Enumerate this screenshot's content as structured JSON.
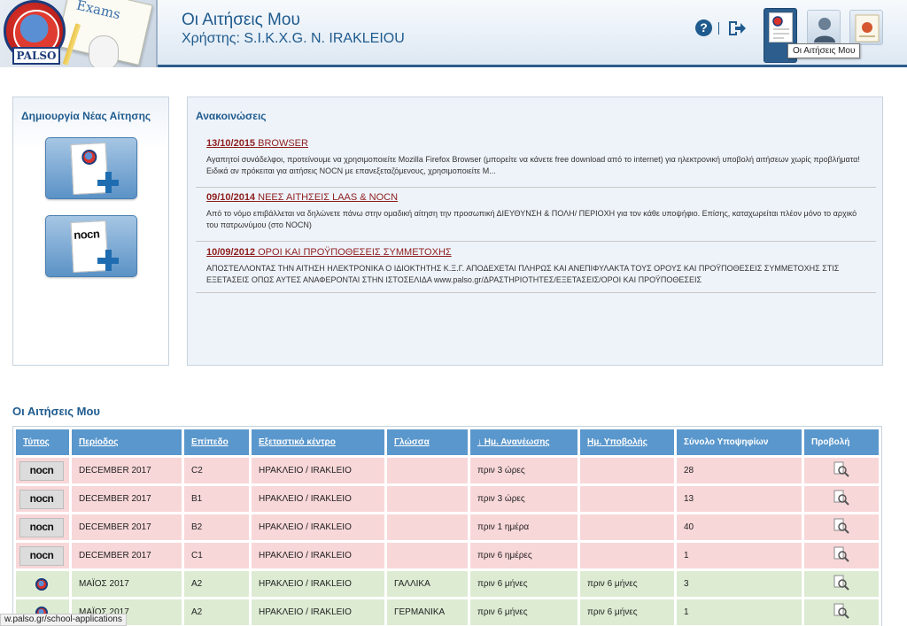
{
  "header": {
    "logo_text": "PALSO",
    "logo_tag": "Exams",
    "title": "Οι Αιτήσεις Μου",
    "user_label": "Χρήστης:",
    "user_name": "S.I.K.X.G. N. IRAKLEIOU",
    "help_symbol": "?",
    "tooltip": "Οι Αιτήσεις Μου"
  },
  "create_panel": {
    "title": "Δημιουργία Νέας Αίτησης",
    "buttons": [
      {
        "kind": "palso",
        "icon": "palso-application-add-icon"
      },
      {
        "kind": "nocn",
        "label": "nocn",
        "icon": "nocn-application-add-icon"
      }
    ]
  },
  "news": {
    "title": "Ανακοινώσεις",
    "items": [
      {
        "date": "13/10/2015",
        "headline": "BROWSER",
        "body": "Αγαπητοί συνάδελφοι, προτείνουμε να χρησιμοποιείτε Mozilla Firefox Browser (μπορείτε να κάνετε free download από το internet) για ηλεκτρονική υποβολή αιτήσεων χωρίς προβλήματα! Ειδικά αν πρόκειται για αιτήσεις NOCN με επανεξεταζόμενους, χρησιμοποιείτε M..."
      },
      {
        "date": "09/10/2014",
        "headline": "ΝΕΕΣ ΑΙΤΗΣΕΙΣ LAAS & NOCN",
        "body": "Από το νόμο επιβάλλεται να δηλώνετε πάνω στην ομαδική αίτηση την προσωπική ΔΙΕΥΘΥΝΣΗ & ΠΟΛΗ/ ΠΕΡΙΟΧΗ για τον κάθε υποψήφιο. Επίσης, καταχωρείται πλέον μόνο το αρχικό του πατρωνύμου (στο NOCN)"
      },
      {
        "date": "10/09/2012",
        "headline": "ΟΡΟΙ ΚΑΙ ΠΡΟΫΠΟΘΕΣΕΙΣ ΣΥΜΜΕΤΟΧΗΣ",
        "body": "ΑΠΟΣΤΕΛΛΟΝΤΑΣ ΤΗΝ ΑΙΤΗΣΗ ΗΛΕΚΤΡΟΝΙΚΑ Ο ΙΔΙΟΚΤΗΤΗΣ Κ.Ξ.Γ. ΑΠΟΔΕΧΕΤΑΙ ΠΛΗΡΩΣ ΚΑΙ ΑΝΕΠΙΦΥΛΑΚΤΑ ΤΟΥΣ ΟΡΟΥΣ ΚΑΙ ΠΡΟΫΠΟΘΕΣΕΙΣ ΣΥΜΜΕΤΟΧΗΣ ΣΤΙΣ ΕΞΕΤΑΣΕΙΣ ΟΠΩΣ ΑΥΤΕΣ ΑΝΑΦΕΡΟΝΤΑΙ ΣΤΗΝ ΙΣΤΟΣΕΛΙΔΑ www.palso.gr/ΔΡΑΣΤΗΡΙΟΤΗΤΕΣ/ΕΞΕΤΑΣΕΙΣ/ΟΡΟΙ ΚΑΙ ΠΡΟΫΠΟΘΕΣΕΙΣ"
      }
    ]
  },
  "applications": {
    "title": "Οι Αιτήσεις Μου",
    "columns": [
      "Τύπος",
      "Περίοδος",
      "Επίπεδο",
      "Εξεταστικό κέντρο",
      "Γλώσσα",
      "↓ Ημ. Ανανέωσης",
      "Ημ. Υποβολής",
      "Σύνολο Υποψηφίων",
      "Προβολή"
    ],
    "rows": [
      {
        "type": "nocn",
        "period": "DECEMBER 2017",
        "level": "C2",
        "center": "ΗΡΑΚΛΕΙΟ / IRAKLEIO",
        "language": "",
        "updated": "πριν 3 ώρες",
        "submitted": "",
        "total": "28",
        "status": "pink"
      },
      {
        "type": "nocn",
        "period": "DECEMBER 2017",
        "level": "B1",
        "center": "ΗΡΑΚΛΕΙΟ / IRAKLEIO",
        "language": "",
        "updated": "πριν 3 ώρες",
        "submitted": "",
        "total": "13",
        "status": "pink"
      },
      {
        "type": "nocn",
        "period": "DECEMBER 2017",
        "level": "B2",
        "center": "ΗΡΑΚΛΕΙΟ / IRAKLEIO",
        "language": "",
        "updated": "πριν 1 ημέρα",
        "submitted": "",
        "total": "40",
        "status": "pink"
      },
      {
        "type": "nocn",
        "period": "DECEMBER 2017",
        "level": "C1",
        "center": "ΗΡΑΚΛΕΙΟ / IRAKLEIO",
        "language": "",
        "updated": "πριν 6 ημέρες",
        "submitted": "",
        "total": "1",
        "status": "pink"
      },
      {
        "type": "palso",
        "period": "ΜΑΪΟΣ 2017",
        "level": "A2",
        "center": "ΗΡΑΚΛΕΙΟ / IRAKLEIO",
        "language": "ΓΑΛΛΙΚΑ",
        "updated": "πριν 6 μήνες",
        "submitted": "πριν 6 μήνες",
        "total": "3",
        "status": "green"
      },
      {
        "type": "palso",
        "period": "ΜΑΪΟΣ 2017",
        "level": "A2",
        "center": "ΗΡΑΚΛΕΙΟ / IRAKLEIO",
        "language": "ΓΕΡΜΑΝΙΚΑ",
        "updated": "πριν 6 μήνες",
        "submitted": "πριν 6 μήνες",
        "total": "1",
        "status": "green"
      }
    ]
  },
  "status_bar": {
    "url": "w.palso.gr/school-applications"
  },
  "colors": {
    "brand": "#1f5b8e",
    "header_cell": "#5a97cc",
    "row_pending": "#f8d7d9",
    "row_submitted": "#dcebd2",
    "news_link": "#8e1e1e"
  }
}
